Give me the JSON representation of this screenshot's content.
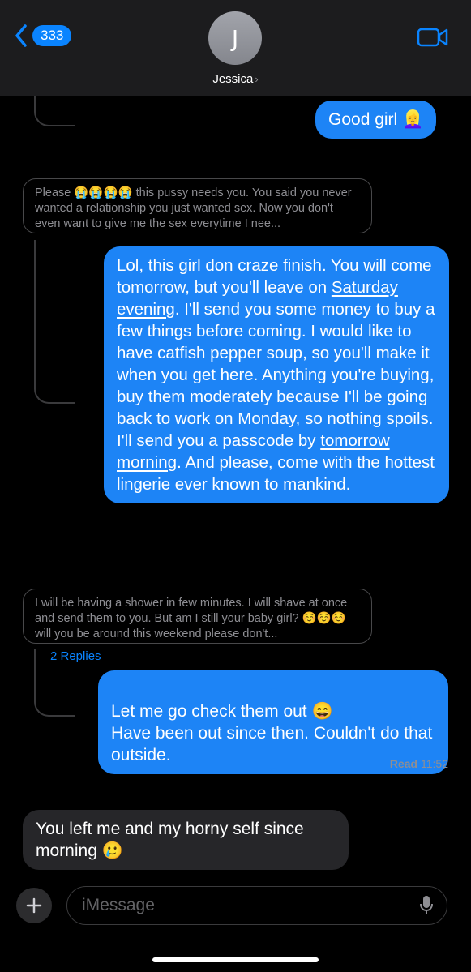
{
  "header": {
    "back_count": "333",
    "avatar_initial": "J",
    "contact_name": "Jessica",
    "contact_chevron": "›",
    "icons": {
      "back": "chevron-left-icon",
      "video": "video-camera-icon"
    },
    "accent_color": "#0a84ff"
  },
  "messages": {
    "good_girl": "Good girl 👱‍♀️",
    "quote1": "Please 😭😭😭😭 this pussy needs you. You said you never wanted a relationship you just wanted sex. Now you don't even want to give me the sex everytime I nee...",
    "long_reply": {
      "p1": "Lol, this girl don craze finish. You will come tomorrow, but you'll leave on ",
      "link1": "Saturday evening",
      "p2": ". I'll send you some money to buy a few things before coming. I would like to have catfish pepper soup, so you'll make it when you get here. Anything you're buying, buy them moderately because I'll be going back to work on Monday, so nothing spoils. I'll send you a passcode by ",
      "link2": "tomorrow morning",
      "p3": ". And please, come with the hottest lingerie ever known to mankind."
    },
    "quote2": "I will be having a shower in few minutes. I will shave at once and send them to you. But am I still your baby girl? ☺️☺️☺️ will you be around this weekend please don't...",
    "replies_link": "2 Replies",
    "check_reply": "Let me go check them out 😄\nHave been out since then. Couldn't do that outside.",
    "read_label": "Read",
    "read_time": "11:52",
    "incoming_last": "You left me and my horny self since morning 🥲"
  },
  "composer": {
    "placeholder": "iMessage",
    "icons": {
      "plus": "plus-icon",
      "mic": "microphone-icon"
    }
  },
  "colors": {
    "outgoing_bubble": "#1d84f6",
    "incoming_bubble": "#262629",
    "background": "#000000"
  }
}
